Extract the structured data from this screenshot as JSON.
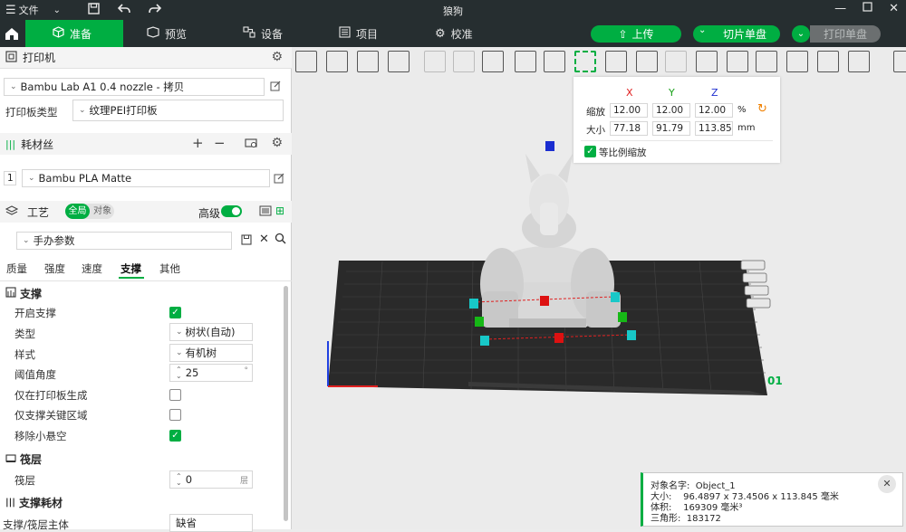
{
  "titlebar": {
    "file_label": "文件",
    "title": "狼狗"
  },
  "nav": {
    "tabs": [
      {
        "label": "准备",
        "icon": "cube-icon"
      },
      {
        "label": "预览",
        "icon": "eye-icon"
      },
      {
        "label": "设备",
        "icon": "device-icon"
      },
      {
        "label": "项目",
        "icon": "project-icon"
      },
      {
        "label": "校准",
        "icon": "gear-icon"
      }
    ],
    "upload_label": "上传",
    "slice_label": "切片单盘",
    "print_label": "打印单盘"
  },
  "printer": {
    "section_title": "打印机",
    "preset": "Bambu Lab A1 0.4 nozzle - 拷贝",
    "plate_type_label": "打印板类型",
    "plate_type_value": "纹理PEI打印板"
  },
  "filament": {
    "section_title": "耗材丝",
    "slot_number": "1",
    "value": "Bambu PLA Matte"
  },
  "process": {
    "section_title": "工艺",
    "toggle_global": "全局",
    "toggle_object": "对象",
    "advanced_label": "高级",
    "preset": "手办参数",
    "tabs": [
      "质量",
      "强度",
      "速度",
      "支撑",
      "其他"
    ],
    "active_tab": "支撑"
  },
  "support": {
    "section_title": "支撑",
    "enable_label": "开启支撑",
    "type_label": "类型",
    "type_value": "树状(自动)",
    "style_label": "样式",
    "style_value": "有机树",
    "threshold_label": "阈值角度",
    "threshold_value": "25",
    "threshold_unit": "°",
    "plate_only_label": "仅在打印板生成",
    "critical_only_label": "仅支撑关键区域",
    "remove_small_label": "移除小悬空"
  },
  "raft": {
    "section_title": "筏层",
    "layers_label": "筏层",
    "layers_value": "0",
    "layers_unit": "层"
  },
  "support_filament": {
    "section_title": "支撑耗材",
    "base_label": "支撑/筏层主体",
    "base_value": "缺省"
  },
  "scale": {
    "col_x": "X",
    "col_y": "Y",
    "col_z": "Z",
    "scale_label": "缩放",
    "scale_x": "12.00",
    "scale_y": "12.00",
    "scale_z": "12.00",
    "scale_unit": "%",
    "size_label": "大小",
    "size_x": "77.18",
    "size_y": "91.79",
    "size_z": "113.85",
    "size_unit": "mm",
    "uniform_label": "等比例缩放"
  },
  "plate": {
    "plate_number": "01"
  },
  "info": {
    "name": "对象名字:  Object_1",
    "size": "大小:    96.4897 x 73.4506 x 113.845 毫米",
    "volume": "体积:    169309 毫米³",
    "triangles": "三角形:  183172"
  },
  "colors": {
    "accent": "#00ae42",
    "dark_bar": "#262e30"
  }
}
